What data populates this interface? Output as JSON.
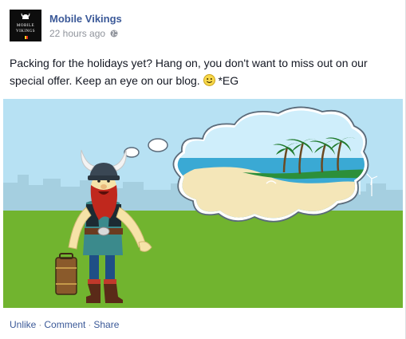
{
  "post": {
    "page_name": "Mobile Vikings",
    "timestamp": "22 hours ago",
    "privacy_icon": "globe-icon",
    "text_before_emoji": "Packing for the holidays yet? Hang on, you don't want to miss out on our special offer. Keep an eye on our blog.",
    "emoji": "smiley-icon",
    "text_after_emoji": "*EG"
  },
  "avatar": {
    "brand_line1": "MOBILE",
    "brand_line2": "VIKINGS",
    "flag_colors": [
      "#000000",
      "#f5d21f",
      "#e1261c"
    ]
  },
  "actions": {
    "unlike": "Unlike",
    "separator": "·",
    "comment": "Comment",
    "share": "Share"
  },
  "colors": {
    "link": "#3b5998",
    "meta": "#90949c",
    "sky": "#b5e0f2",
    "grass": "#72b531"
  }
}
